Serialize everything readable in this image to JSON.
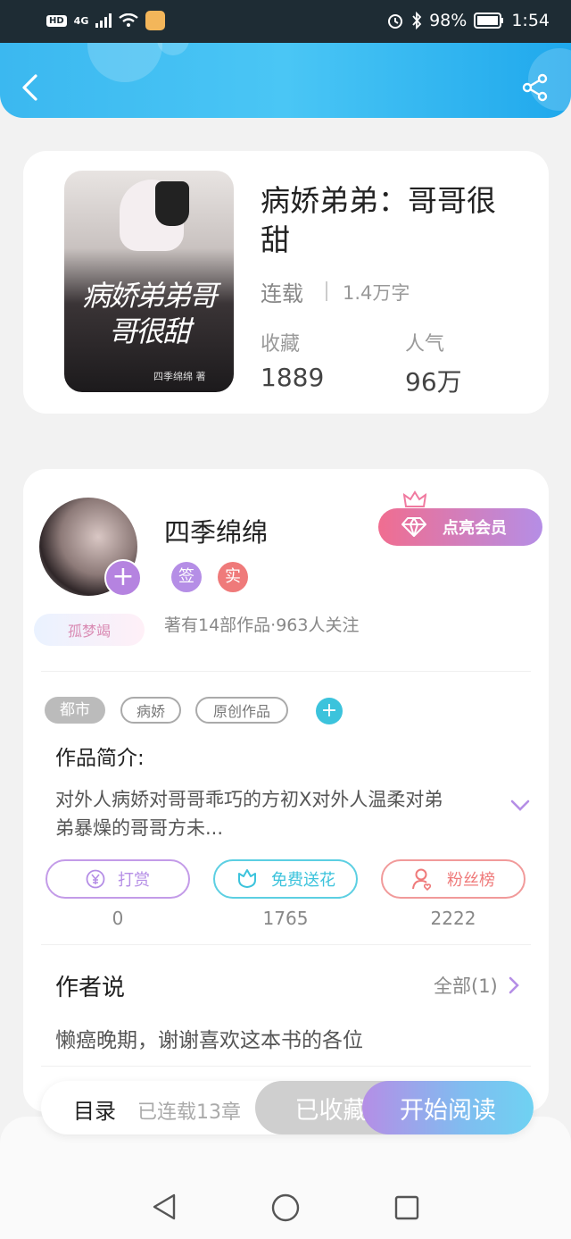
{
  "status": {
    "signal": "4G",
    "battery": "98%",
    "time": "1:54"
  },
  "header": {
    "back_icon": "chevron-left-icon",
    "share_icon": "share-icon"
  },
  "book": {
    "title": "病娇弟弟：哥哥很甜",
    "status": "连载",
    "word_count": "1.4万字",
    "favorites_label": "收藏",
    "favorites_value": "1889",
    "popularity_label": "人气",
    "popularity_value": "96万",
    "cover_title": "病娇弟弟哥哥很甜",
    "cover_author": "四季绵绵 著"
  },
  "author": {
    "name": "四季绵绵",
    "badge_signed": "签",
    "badge_verified": "实",
    "stats": "著有14部作品·963人关注",
    "tag": "孤梦竭",
    "vip_button": "点亮会员"
  },
  "tags": [
    "都市",
    "病娇",
    "原创作品"
  ],
  "intro": {
    "heading": "作品简介:",
    "text_line1": "对外人病娇对哥哥乖巧的方初X对外人温柔对弟",
    "text_line2": "弟暴燥的哥哥方未..."
  },
  "actions": {
    "tip_label": "打赏",
    "tip_count": "0",
    "flower_label": "免费送花",
    "flower_count": "1765",
    "fans_label": "粉丝榜",
    "fans_count": "2222"
  },
  "author_says": {
    "heading": "作者说",
    "all_label": "全部(1)",
    "text": "懒癌晚期，谢谢喜欢这本书的各位"
  },
  "bottom": {
    "toc_label": "目录",
    "chapters": "已连载13章",
    "collected": "已收藏",
    "read": "开始阅读"
  },
  "colors": {
    "header_blue": "#3bb8f0",
    "vip_pink": "#f07aa0",
    "purple": "#b58ee6",
    "cyan": "#3cc3dc",
    "red": "#ef7a7a"
  }
}
